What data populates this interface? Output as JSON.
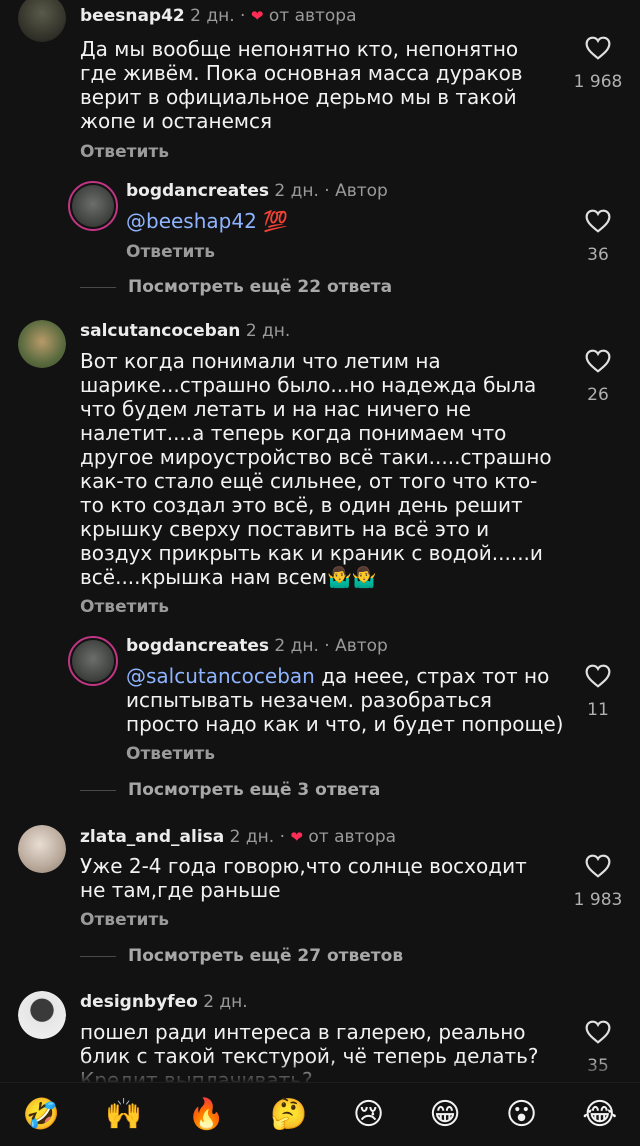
{
  "comments": [
    {
      "user": "beesnap42",
      "time": "2 дн.",
      "author_like": "от автора",
      "text": "Да мы вообще непонятно кто, непонятно где живём. Пока основная масса дураков верит в официальное дерьмо мы в такой жопе и останемся",
      "reply_label": "Ответить",
      "likes": "1 968"
    },
    {
      "user": "bogdancreates",
      "time": "2 дн. · Автор",
      "mention": "@beeshap42",
      "text": "💯",
      "reply_label": "Ответить",
      "likes": "36"
    },
    {
      "more": "Посмотреть ещё 22 ответа"
    },
    {
      "user": "salcutancoceban",
      "time": "2 дн.",
      "text": "Вот когда понимали что летим на шарике...страшно было...но надежда была что будем летать и на нас ничего не налетит....а теперь когда понимаем что другое мироустройство всё таки.....страшно как-то стало ещё сильнее, от того что кто-то кто создал это всё, в один день решит крышку сверху поставить на всё это и воздух прикрыть как и краник с водой......и всё....крышка нам всем🤷‍♂️🤷‍♂️",
      "reply_label": "Ответить",
      "likes": "26"
    },
    {
      "user": "bogdancreates",
      "time": "2 дн. · Автор",
      "mention": "@salcutancoceban",
      "text": " да неее, страх тот но испытывать незачем. разобраться просто надо как и что, и будет попроще)",
      "reply_label": "Ответить",
      "likes": "11"
    },
    {
      "more": "Посмотреть ещё 3 ответа"
    },
    {
      "user": "zlata_and_alisa",
      "time": "2 дн.",
      "author_like": "от автора",
      "text": "Уже 2-4 года говорю,что солнце восходит не там,где раньше",
      "reply_label": "Ответить",
      "likes": "1 983"
    },
    {
      "more": "Посмотреть ещё 27 ответов"
    },
    {
      "user": "designbyfeo",
      "time": "2 дн.",
      "text": "пошел ради интереса в галерею, реально блик с такой текстурой, чё теперь делать? Кредит выплачивать?",
      "likes": "35"
    }
  ],
  "emoji_bar": [
    "🤣",
    "🙌",
    "🔥",
    "🤔",
    "😢",
    "😁",
    "😮",
    "😂"
  ],
  "colors": {
    "background": "#121212",
    "mention": "#8fb4ff",
    "heart_red": "#ff2d55",
    "story_ring": "#c13584"
  }
}
